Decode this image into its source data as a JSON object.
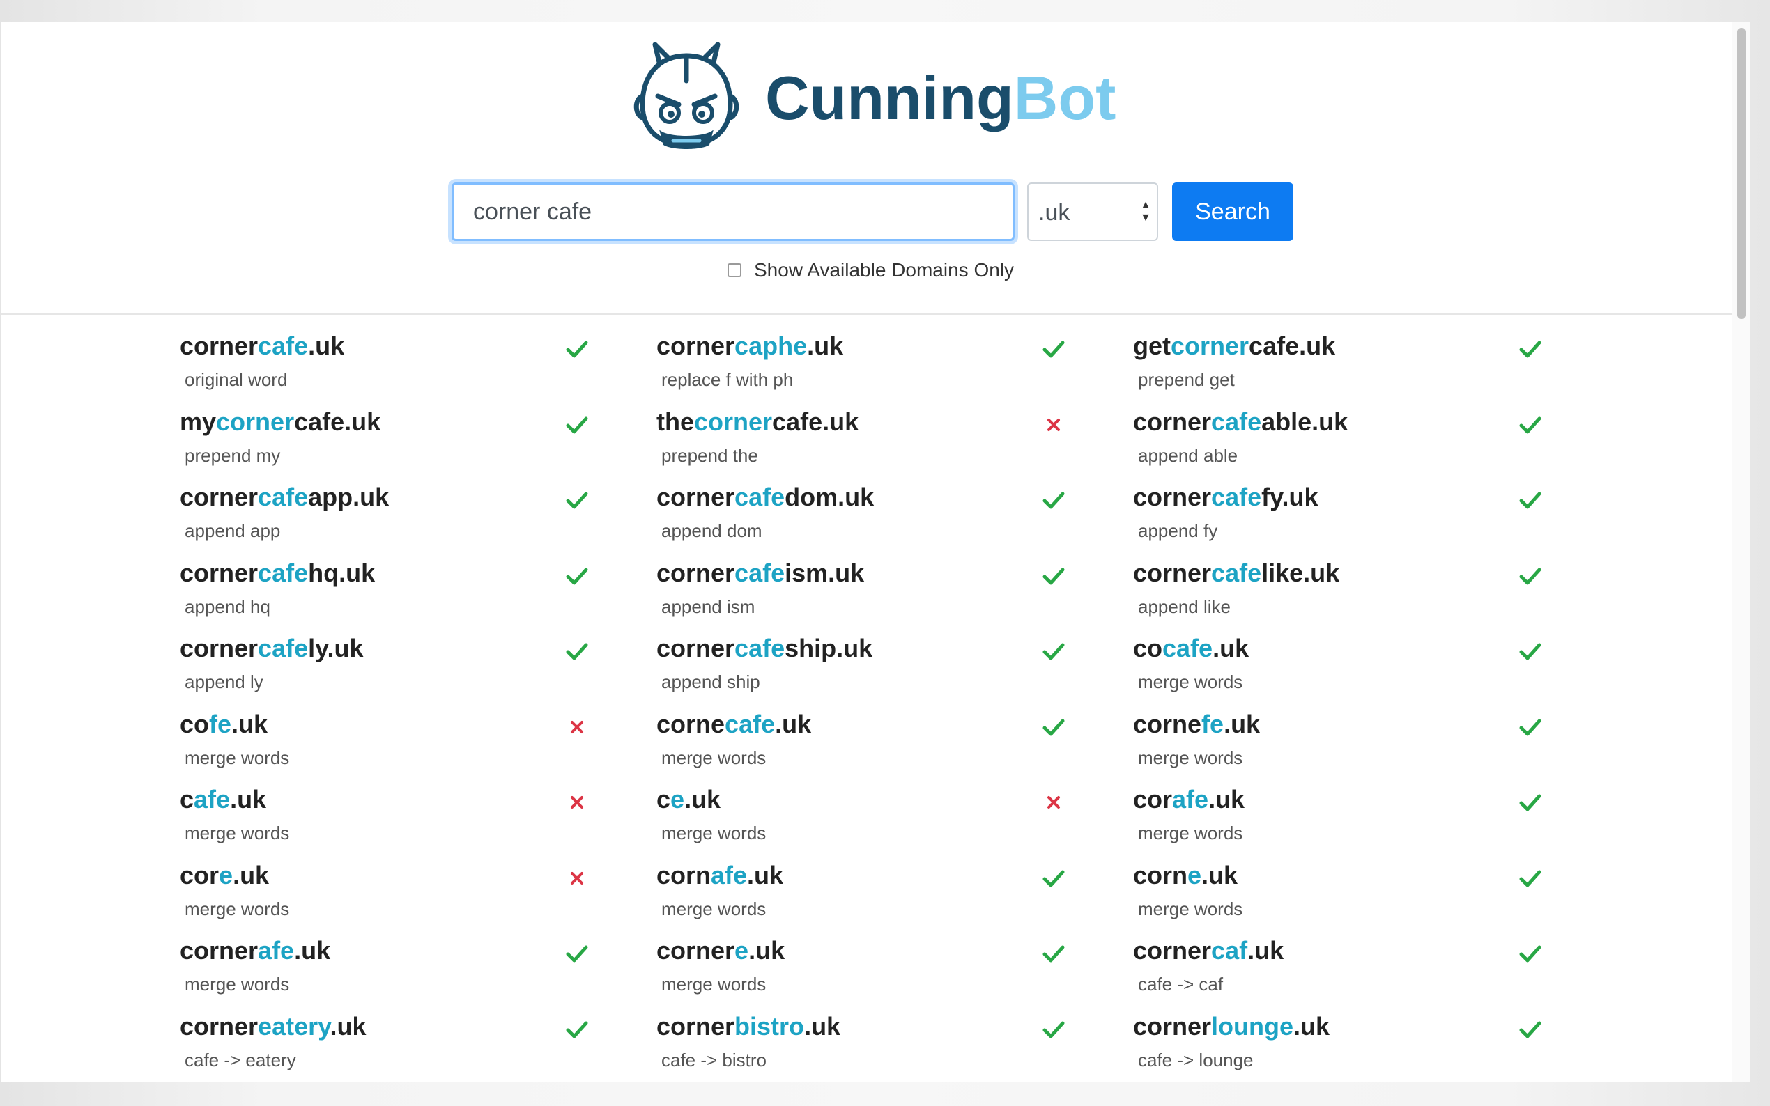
{
  "brand": {
    "name_part1": "Cunning",
    "name_part2": "Bot",
    "color_part1": "#1a4d6b",
    "color_part2": "#7ccbee",
    "logo_icon": "robot-head-icon"
  },
  "search": {
    "query": "corner cafe",
    "tld_selected": ".uk",
    "button_label": "Search",
    "button_color": "#0d7bf2",
    "available_only_label": "Show Available Domains Only",
    "available_only_checked": false
  },
  "colors": {
    "highlight": "#1da3c4",
    "available": "#28a745",
    "unavailable": "#dc3545"
  },
  "results": {
    "columns": [
      [
        {
          "parts": [
            [
              "corner",
              false
            ],
            [
              "cafe",
              true
            ],
            [
              ".uk",
              false
            ]
          ],
          "desc": "original word",
          "available": true
        },
        {
          "parts": [
            [
              "my",
              false
            ],
            [
              "corner",
              true
            ],
            [
              "cafe.uk",
              false
            ]
          ],
          "desc": "prepend my",
          "available": true
        },
        {
          "parts": [
            [
              "corner",
              false
            ],
            [
              "cafe",
              true
            ],
            [
              "app.uk",
              false
            ]
          ],
          "desc": "append app",
          "available": true
        },
        {
          "parts": [
            [
              "corner",
              false
            ],
            [
              "cafe",
              true
            ],
            [
              "hq.uk",
              false
            ]
          ],
          "desc": "append hq",
          "available": true
        },
        {
          "parts": [
            [
              "corner",
              false
            ],
            [
              "cafe",
              true
            ],
            [
              "ly.uk",
              false
            ]
          ],
          "desc": "append ly",
          "available": true
        },
        {
          "parts": [
            [
              "co",
              false
            ],
            [
              "fe",
              true
            ],
            [
              ".uk",
              false
            ]
          ],
          "desc": "merge words",
          "available": false
        },
        {
          "parts": [
            [
              "c",
              false
            ],
            [
              "afe",
              true
            ],
            [
              ".uk",
              false
            ]
          ],
          "desc": "merge words",
          "available": false
        },
        {
          "parts": [
            [
              "cor",
              false
            ],
            [
              "e",
              true
            ],
            [
              ".uk",
              false
            ]
          ],
          "desc": "merge words",
          "available": false
        },
        {
          "parts": [
            [
              "corner",
              false
            ],
            [
              "afe",
              true
            ],
            [
              ".uk",
              false
            ]
          ],
          "desc": "merge words",
          "available": true
        },
        {
          "parts": [
            [
              "corner",
              false
            ],
            [
              "eatery",
              true
            ],
            [
              ".uk",
              false
            ]
          ],
          "desc": "cafe -> eatery",
          "available": true
        }
      ],
      [
        {
          "parts": [
            [
              "corner",
              false
            ],
            [
              "caphe",
              true
            ],
            [
              ".uk",
              false
            ]
          ],
          "desc": "replace f with ph",
          "available": true
        },
        {
          "parts": [
            [
              "the",
              false
            ],
            [
              "corner",
              true
            ],
            [
              "cafe.uk",
              false
            ]
          ],
          "desc": "prepend the",
          "available": false
        },
        {
          "parts": [
            [
              "corner",
              false
            ],
            [
              "cafe",
              true
            ],
            [
              "dom.uk",
              false
            ]
          ],
          "desc": "append dom",
          "available": true
        },
        {
          "parts": [
            [
              "corner",
              false
            ],
            [
              "cafe",
              true
            ],
            [
              "ism.uk",
              false
            ]
          ],
          "desc": "append ism",
          "available": true
        },
        {
          "parts": [
            [
              "corner",
              false
            ],
            [
              "cafe",
              true
            ],
            [
              "ship.uk",
              false
            ]
          ],
          "desc": "append ship",
          "available": true
        },
        {
          "parts": [
            [
              "corne",
              false
            ],
            [
              "cafe",
              true
            ],
            [
              ".uk",
              false
            ]
          ],
          "desc": "merge words",
          "available": true
        },
        {
          "parts": [
            [
              "c",
              false
            ],
            [
              "e",
              true
            ],
            [
              ".uk",
              false
            ]
          ],
          "desc": "merge words",
          "available": false
        },
        {
          "parts": [
            [
              "corn",
              false
            ],
            [
              "afe",
              true
            ],
            [
              ".uk",
              false
            ]
          ],
          "desc": "merge words",
          "available": true
        },
        {
          "parts": [
            [
              "corner",
              false
            ],
            [
              "e",
              true
            ],
            [
              ".uk",
              false
            ]
          ],
          "desc": "merge words",
          "available": true
        },
        {
          "parts": [
            [
              "corner",
              false
            ],
            [
              "bistro",
              true
            ],
            [
              ".uk",
              false
            ]
          ],
          "desc": "cafe -> bistro",
          "available": true
        }
      ],
      [
        {
          "parts": [
            [
              "get",
              false
            ],
            [
              "corner",
              true
            ],
            [
              "cafe.uk",
              false
            ]
          ],
          "desc": "prepend get",
          "available": true
        },
        {
          "parts": [
            [
              "corner",
              false
            ],
            [
              "cafe",
              true
            ],
            [
              "able.uk",
              false
            ]
          ],
          "desc": "append able",
          "available": true
        },
        {
          "parts": [
            [
              "corner",
              false
            ],
            [
              "cafe",
              true
            ],
            [
              "fy.uk",
              false
            ]
          ],
          "desc": "append fy",
          "available": true
        },
        {
          "parts": [
            [
              "corner",
              false
            ],
            [
              "cafe",
              true
            ],
            [
              "like.uk",
              false
            ]
          ],
          "desc": "append like",
          "available": true
        },
        {
          "parts": [
            [
              "co",
              false
            ],
            [
              "cafe",
              true
            ],
            [
              ".uk",
              false
            ]
          ],
          "desc": "merge words",
          "available": true
        },
        {
          "parts": [
            [
              "corne",
              false
            ],
            [
              "fe",
              true
            ],
            [
              ".uk",
              false
            ]
          ],
          "desc": "merge words",
          "available": true
        },
        {
          "parts": [
            [
              "cor",
              false
            ],
            [
              "afe",
              true
            ],
            [
              ".uk",
              false
            ]
          ],
          "desc": "merge words",
          "available": true
        },
        {
          "parts": [
            [
              "corn",
              false
            ],
            [
              "e",
              true
            ],
            [
              ".uk",
              false
            ]
          ],
          "desc": "merge words",
          "available": true
        },
        {
          "parts": [
            [
              "corner",
              false
            ],
            [
              "caf",
              true
            ],
            [
              ".uk",
              false
            ]
          ],
          "desc": "cafe -> caf",
          "available": true
        },
        {
          "parts": [
            [
              "corner",
              false
            ],
            [
              "lounge",
              true
            ],
            [
              ".uk",
              false
            ]
          ],
          "desc": "cafe -> lounge",
          "available": true
        }
      ]
    ]
  }
}
